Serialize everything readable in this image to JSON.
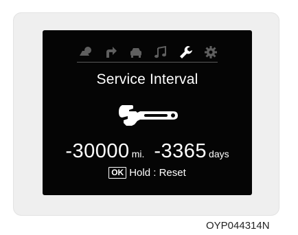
{
  "cluster": {
    "tabs": [
      {
        "icon": "trip-computer-icon",
        "active": false
      },
      {
        "icon": "turn-by-turn-icon",
        "active": false
      },
      {
        "icon": "car-icon",
        "active": false
      },
      {
        "icon": "music-icon",
        "active": false
      },
      {
        "icon": "wrench-icon",
        "active": true
      },
      {
        "icon": "gear-icon",
        "active": false
      }
    ],
    "title": "Service Interval",
    "service_icon": "adjustable-wrench-icon",
    "distance_value": "-30000",
    "distance_unit": "mi.",
    "days_value": "-3365",
    "days_unit": "days",
    "ok_label": "OK",
    "hold_reset_label": "Hold : Reset"
  },
  "caption": "OYP044314N",
  "colors": {
    "screen_bg": "#050505",
    "inactive_icon": "#5f5f5f",
    "active_icon": "#ffffff"
  }
}
